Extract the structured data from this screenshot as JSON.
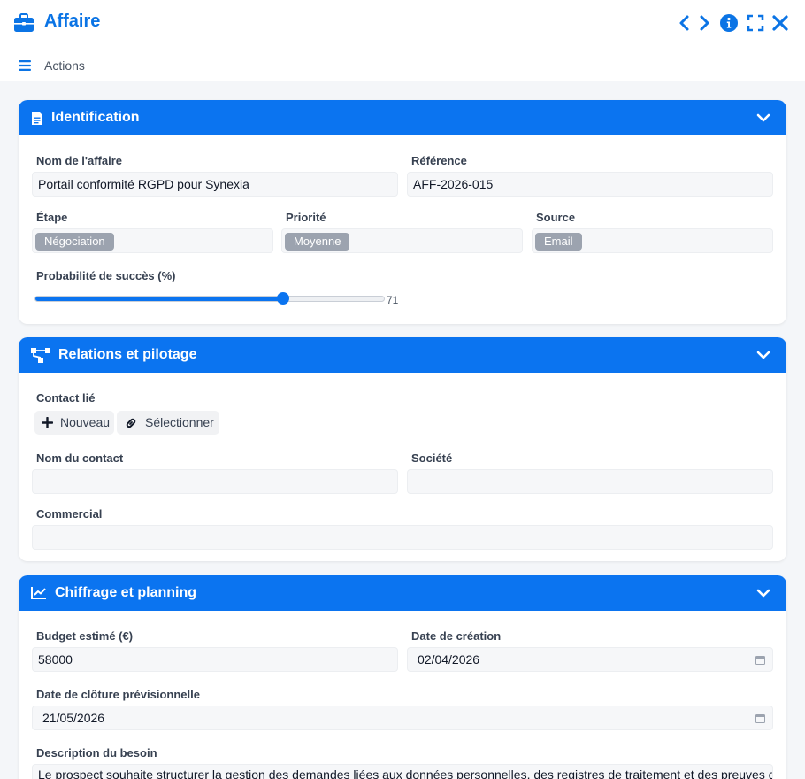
{
  "header": {
    "title": "Affaire",
    "actions_label": "Actions"
  },
  "colors": {
    "accent": "#0b74f0",
    "tag_bg": "#9ca3af"
  },
  "identification": {
    "title": "Identification",
    "deal_name_label": "Nom de l'affaire",
    "deal_name_value": "Portail conformité RGPD pour Synexia",
    "reference_label": "Référence",
    "reference_value": "AFF-2026-015",
    "stage_label": "Étape",
    "stage_value": "Négociation",
    "priority_label": "Priorité",
    "priority_value": "Moyenne",
    "source_label": "Source",
    "source_value": "Email",
    "probability_label": "Probabilité de succès (%)",
    "probability_value": 71,
    "probability_display": "71"
  },
  "relations": {
    "title": "Relations et pilotage",
    "linked_contact_label": "Contact lié",
    "new_button": "Nouveau",
    "select_button": "Sélectionner",
    "contact_name_label": "Nom du contact",
    "contact_name_value": "",
    "company_label": "Société",
    "company_value": "",
    "sales_label": "Commercial",
    "sales_value": ""
  },
  "pricing": {
    "title": "Chiffrage et planning",
    "budget_label": "Budget estimé (€)",
    "budget_value": "58000",
    "created_label": "Date de création",
    "created_value": "02/04/2026",
    "close_label": "Date de clôture prévisionnelle",
    "close_value": "21/05/2026",
    "description_label": "Description du besoin",
    "description_value": "Le prospect souhaite structurer la gestion des demandes liées aux données personnelles, des registres de traitement et des preuves de"
  }
}
